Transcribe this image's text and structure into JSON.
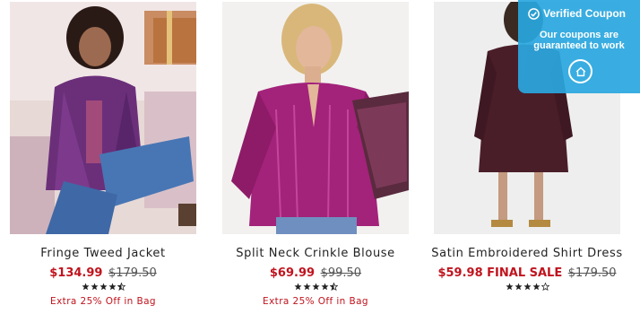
{
  "products": [
    {
      "name": "Fringe Tweed Jacket",
      "sale_price": "$134.99",
      "original_price": "$179.50",
      "rating": 4.5,
      "promo": "Extra 25% Off in Bag"
    },
    {
      "name": "Split Neck Crinkle Blouse",
      "sale_price": "$69.99",
      "original_price": "$99.50",
      "rating": 4.5,
      "promo": "Extra 25% Off in Bag"
    },
    {
      "name": "Satin Embroidered Shirt Dress",
      "sale_price": "$59.98 FINAL SALE",
      "original_price": "$179.50",
      "rating": 4,
      "promo": ""
    }
  ],
  "coupon": {
    "title": "Verified Coupon",
    "line1": "Our coupons are",
    "line2": "guaranteed to work",
    "check_icon": "check-circle-icon",
    "home_icon": "home-icon"
  },
  "colors": {
    "sale": "#c0141e",
    "coupon_bg": "#29a7e0",
    "star": "#222222"
  }
}
